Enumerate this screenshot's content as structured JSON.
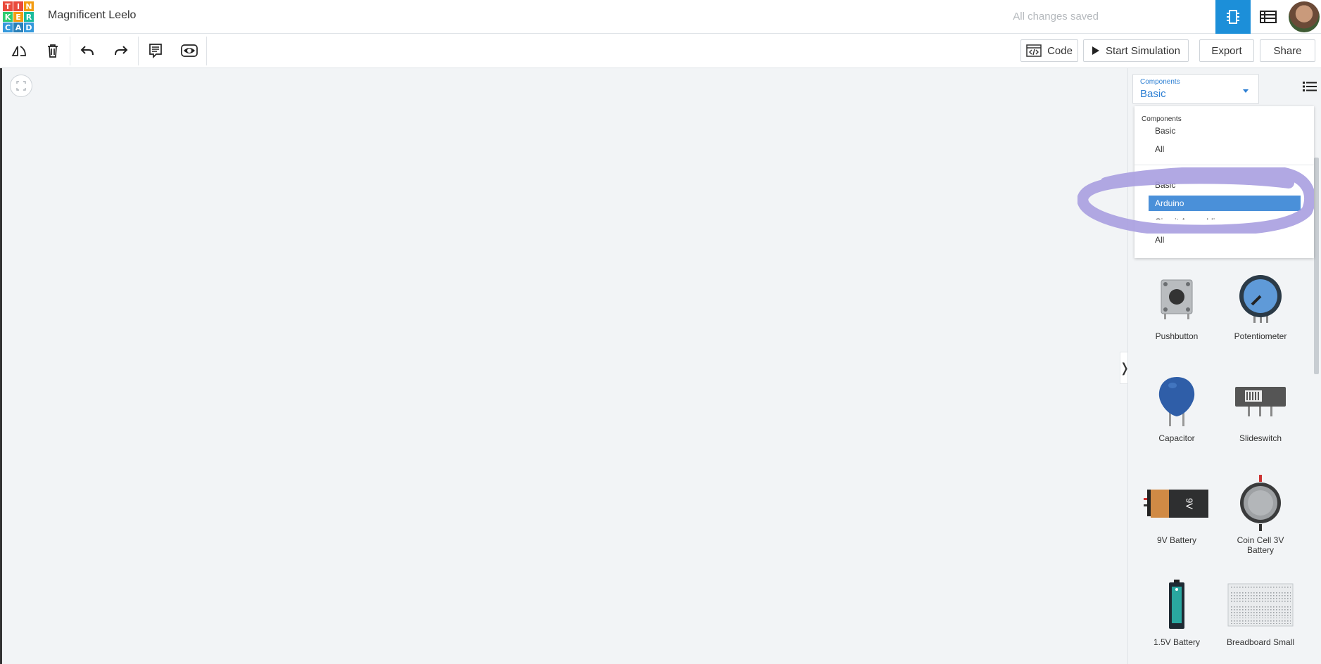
{
  "app": {
    "logo_letters": [
      "T",
      "I",
      "N",
      "K",
      "E",
      "R",
      "C",
      "A",
      "D"
    ],
    "logo_colors": [
      "#e94b3c",
      "#e94b3c",
      "#f39c12",
      "#2ecc71",
      "#f39c12",
      "#1abc9c",
      "#3498db",
      "#2980b9",
      "#3498db"
    ],
    "project_title": "Magnificent Leelo",
    "save_status": "All changes saved"
  },
  "toolbar": {
    "code_label": "Code",
    "simulate_label": "Start Simulation",
    "export_label": "Export",
    "share_label": "Share"
  },
  "canvas": {
    "collapse_glyph": "❭"
  },
  "panel": {
    "select_label": "Components",
    "select_value": "Basic",
    "dropdown": {
      "group_label": "Components",
      "group_items": [
        "Basic",
        "All"
      ],
      "section_items": [
        "Basic",
        "Arduino",
        "Circuit Assembli",
        "All"
      ],
      "selected": "Arduino"
    },
    "components": [
      {
        "name": "Pushbutton",
        "icon": "pushbutton-icon"
      },
      {
        "name": "Potentiometer",
        "icon": "potentiometer-icon"
      },
      {
        "name": "Capacitor",
        "icon": "capacitor-icon"
      },
      {
        "name": "Slideswitch",
        "icon": "slideswitch-icon"
      },
      {
        "name": "9V Battery",
        "icon": "battery-9v-icon",
        "label": "9V"
      },
      {
        "name": "Coin Cell 3V Battery",
        "icon": "coin-cell-icon"
      },
      {
        "name": "1.5V Battery",
        "icon": "battery-aa-icon"
      },
      {
        "name": "Breadboard Small",
        "icon": "breadboard-icon"
      }
    ]
  },
  "colors": {
    "accent": "#1c8fd9",
    "selection": "#4a90d9",
    "annotation": "#a99ee0"
  }
}
